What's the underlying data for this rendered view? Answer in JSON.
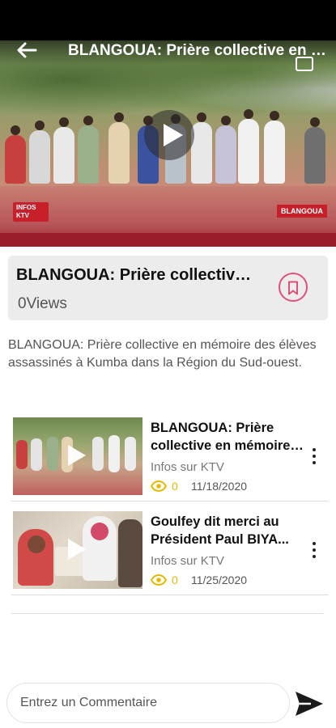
{
  "player": {
    "title": "BLANGOUA: Prière collective en mémoire des élèves assassinés à Kumba dans la Région du Sud-ouest",
    "overlay_brand": "INFOS KTV",
    "overlay_tag": "BLANGOUA"
  },
  "video": {
    "title": "BLANGOUA: Prière collective en mémoire des élèves assassinés à Kumba dans la Région du Sud-ouest",
    "views": "0Views",
    "description": "BLANGOUA: Prière collective en mémoire des élèves assassinés à Kumba dans la Région du Sud-ouest."
  },
  "related": [
    {
      "title": "BLANGOUA: Prière collective en mémoire des élèves assassinés",
      "source": "Infos sur KTV",
      "views": "0",
      "date": "11/18/2020"
    },
    {
      "title": "Goulfey dit merci au Président Paul BIYA...",
      "source": "Infos sur KTV",
      "views": "0",
      "date": "11/25/2020"
    }
  ],
  "comment": {
    "placeholder": "Entrez un Commentaire"
  },
  "colors": {
    "accent": "#e0507a",
    "views_yellow": "#e6b800",
    "brand_red": "#c8202b"
  },
  "icons": {
    "back": "arrow-left-icon",
    "play": "play-icon",
    "bookmark": "bookmark-icon",
    "eye": "eye-icon",
    "more": "more-vertical-icon",
    "send": "send-icon"
  }
}
